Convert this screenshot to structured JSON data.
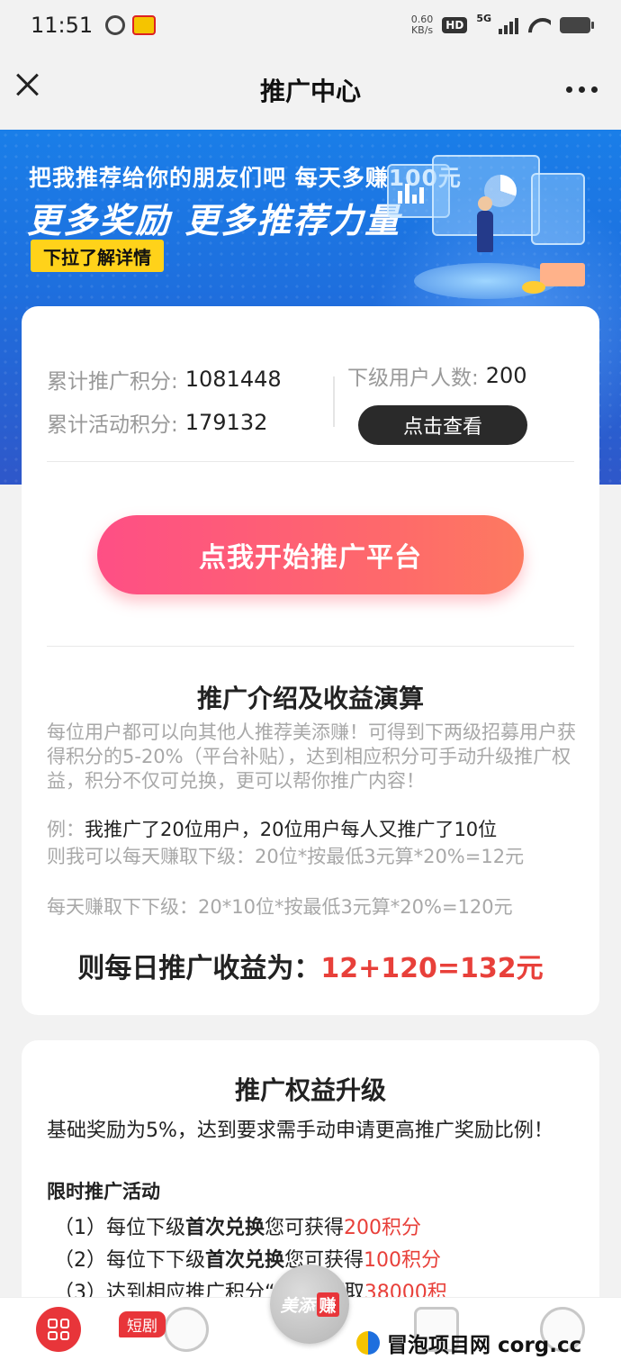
{
  "status_bar": {
    "time": "11:51",
    "app_badge": "美团",
    "net_speed_value": "0.60",
    "net_speed_unit": "KB/s",
    "hd": "HD",
    "network": "5G"
  },
  "header": {
    "title": "推广中心"
  },
  "banner": {
    "line1": "把我推荐给你的朋友们吧 每天多赚100元",
    "line2": "更多奖励 更多推荐力量",
    "button": "下拉了解详情"
  },
  "stats": {
    "total_promo_label": "累计推广积分:",
    "total_promo_value": "1081448",
    "total_activity_label": "累计活动积分:",
    "total_activity_value": "179132",
    "sub_users_label": "下级用户人数:",
    "sub_users_value": "200",
    "view_button": "点击查看"
  },
  "start_button": "点我开始推广平台",
  "intro": {
    "title": "推广介绍及收益演算",
    "para1": "每位用户都可以向其他人推荐美添赚！可得到下两级招募用户获得积分的5-20%（平台补贴），达到相应积分可手动升级推广权益，积分不仅可兑换，更可以帮你推广内容！",
    "example_prefix": "例：",
    "example_text": "我推广了20位用户，20位用户每人又推广了10位",
    "calc1": "则我可以每天赚取下级：20位*按最低3元算*20%=12元",
    "calc2": "每天赚取下下级：20*10位*按最低3元算*20%=120元",
    "result_label": "则每日推广收益为：",
    "result_value": "12+120=132元"
  },
  "upgrade": {
    "title": "推广权益升级",
    "para": "基础奖励为5%，达到要求需手动申请更高推广奖励比例！",
    "subtitle": "限时推广活动",
    "items": [
      {
        "prefix": "（1）每位下级",
        "bold": "首次兑换",
        "mid": "您可获得",
        "red": "200积分"
      },
      {
        "prefix": "（2）每位下下级",
        "bold": "首次兑换",
        "mid": "您可获得",
        "red": "100积分"
      },
      {
        "prefix": "（3）达到相应推广积分",
        "bold": "",
        "mid": "“我的”领取",
        "red": "38000积"
      }
    ]
  },
  "bottom_nav": {
    "short_drama_badge": "短剧",
    "center_text": "美添",
    "center_highlight": "赚"
  },
  "watermark": {
    "text": "冒泡项目网 corg.cc"
  },
  "colors": {
    "accent_red": "#e8403a",
    "button_gradient_start": "#fe4f85",
    "button_gradient_end": "#fd7a60",
    "banner_blue": "#1e6fde",
    "banner_yellow": "#ffd21a"
  }
}
